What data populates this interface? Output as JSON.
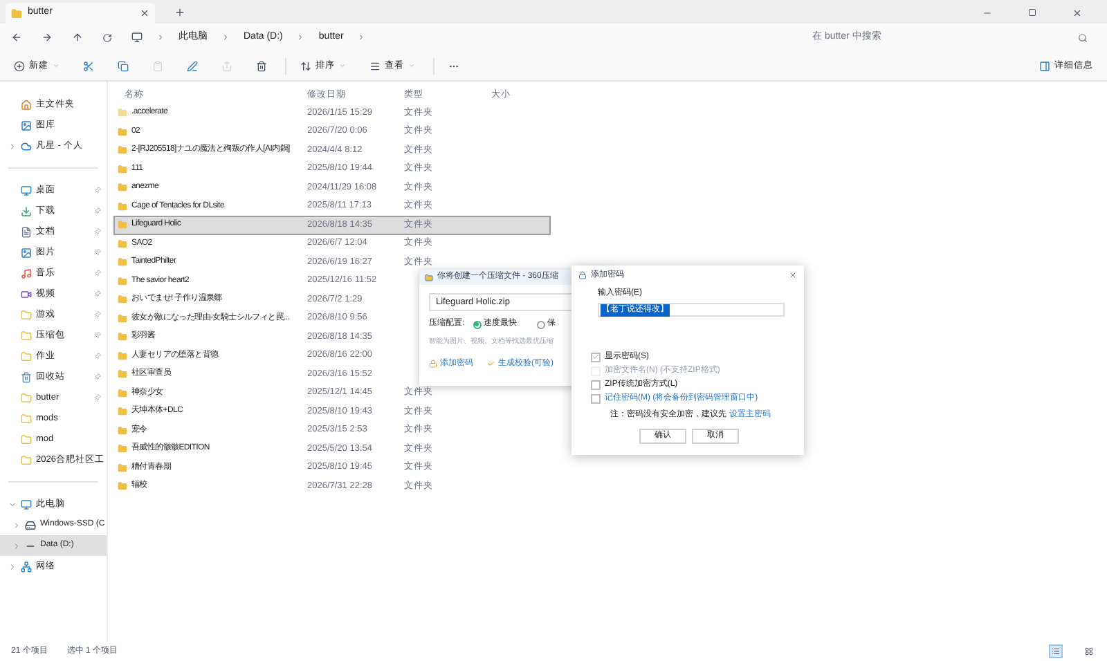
{
  "tab": {
    "title": "butter"
  },
  "address": {
    "breadcrumbs": [
      "此电脑",
      "Data (D:)",
      "butter"
    ],
    "search": {
      "placeholder": "在 butter 中搜索"
    }
  },
  "toolbar": {
    "actions": [
      {
        "kind": "new",
        "label": "新建",
        "disabled": false
      },
      {
        "kind": "cut",
        "disabled": false
      },
      {
        "kind": "copy",
        "disabled": false
      },
      {
        "kind": "paste",
        "disabled": true
      },
      {
        "kind": "rename",
        "disabled": false
      },
      {
        "kind": "share",
        "disabled": true
      },
      {
        "kind": "delete",
        "disabled": false
      },
      {
        "kind": "sort",
        "label": "排序",
        "disabled": false
      },
      {
        "kind": "view",
        "label": "查看",
        "disabled": false
      },
      {
        "kind": "more",
        "disabled": false
      }
    ],
    "details": "详细信息"
  },
  "sidebar": {
    "top": [
      {
        "kind": "home",
        "label": "主文件夹"
      },
      {
        "kind": "gallery",
        "label": "图库"
      },
      {
        "kind": "cloud",
        "label": "凡星 - 个人",
        "expandable": true
      }
    ],
    "quick": [
      {
        "kind": "desktop",
        "label": "桌面",
        "pinned": true
      },
      {
        "kind": "download",
        "label": "下载",
        "pinned": true
      },
      {
        "kind": "document",
        "label": "文档",
        "pinned": true
      },
      {
        "kind": "picture",
        "label": "图片",
        "pinned": true
      },
      {
        "kind": "music",
        "label": "音乐",
        "pinned": true
      },
      {
        "kind": "video",
        "label": "视频",
        "pinned": true
      },
      {
        "kind": "folder",
        "label": "游戏",
        "pinned": true
      },
      {
        "kind": "folder",
        "label": "压缩包",
        "pinned": true
      },
      {
        "kind": "folder",
        "label": "作业",
        "pinned": true
      },
      {
        "kind": "recycle",
        "label": "回收站",
        "pinned": true
      },
      {
        "kind": "folder",
        "label": "butter",
        "pinned": true
      },
      {
        "kind": "folder",
        "label": "mods",
        "pinned": false
      },
      {
        "kind": "folder",
        "label": "mod",
        "pinned": false
      },
      {
        "kind": "folder",
        "label": "2026合肥社区工"
      }
    ],
    "tree": [
      {
        "kind": "pc",
        "label": "此电脑",
        "expanded": true,
        "selected": false,
        "children": [
          {
            "kind": "ssd",
            "label": "Windows-SSD (C",
            "selected": false
          },
          {
            "kind": "drive",
            "label": "Data (D:)",
            "selected": true
          }
        ]
      },
      {
        "kind": "network",
        "label": "网络",
        "expanded": false,
        "selected": false
      }
    ]
  },
  "table": {
    "columns": [
      "名称",
      "修改日期",
      "类型",
      "大小"
    ],
    "rows": [
      {
        "name": ".accelerate",
        "date": "2026/1/15 15:29",
        "type": "文件夹",
        "selected": false,
        "hidden_item": true
      },
      {
        "name": "02",
        "date": "2026/7/20 0:06",
        "type": "文件夹",
        "selected": false
      },
      {
        "name": "2-[RJ205518]ナユの魔法と殉叛の作人[AI内鍋]",
        "date": "2024/4/4 8:12",
        "type": "文件夹",
        "selected": false
      },
      {
        "name": "111",
        "date": "2025/8/10 19:44",
        "type": "文件夹",
        "selected": false
      },
      {
        "name": "anezme",
        "date": "2024/11/29 16:08",
        "type": "文件夹",
        "selected": false
      },
      {
        "name": "Cage of Tentacles for DLsite",
        "date": "2025/8/11 17:13",
        "type": "文件夹",
        "selected": false
      },
      {
        "name": "Lifeguard Holic",
        "date": "2026/8/18 14:35",
        "type": "文件夹",
        "selected": true
      },
      {
        "name": "SAO2",
        "date": "2026/6/7 12:04",
        "type": "文件夹",
        "selected": false
      },
      {
        "name": "TaintedPhilter",
        "date": "2026/6/19 16:27",
        "type": "文件夹",
        "selected": false
      },
      {
        "name": "The savior heart2",
        "date": "2025/12/16 11:52",
        "selected": false
      },
      {
        "name": "おいでませ! 子作り温泉郷",
        "date": "2026/7/2 1:29",
        "selected": false
      },
      {
        "name": "彼女が敵になった理由-女騎士シルフィと罠...",
        "date": "2026/8/10 9:56",
        "selected": false
      },
      {
        "name": "彩羽酱",
        "date": "2026/8/18 14:35",
        "selected": false
      },
      {
        "name": "人妻セリアの堕落と背徳",
        "date": "2026/8/16 22:00",
        "selected": false
      },
      {
        "name": "社区审查员",
        "date": "2026/3/16 15:52",
        "selected": false
      },
      {
        "name": "神奈少女",
        "date": "2025/12/1 14:45",
        "type": "文件夹",
        "selected": false
      },
      {
        "name": "天坤本体+DLC",
        "date": "2025/8/10 19:43",
        "type": "文件夹",
        "selected": false
      },
      {
        "name": "宠令",
        "date": "2025/3/15 2:53",
        "type": "文件夹",
        "selected": false
      },
      {
        "name": "吾威性的骸骸EDITION",
        "date": "2025/5/20 13:54",
        "type": "文件夹",
        "selected": false
      },
      {
        "name": "糟付青春期",
        "date": "2025/8/10 19:45",
        "type": "文件夹",
        "selected": false
      },
      {
        "name": "辐校",
        "date": "2026/7/31 22:28",
        "type": "文件夹",
        "selected": false
      }
    ]
  },
  "compress_dialog": {
    "title": "你将创建一个压缩文件 - 360压缩",
    "filename": "Lifeguard Holic.zip",
    "config_label": "压缩配置:",
    "options": [
      {
        "label": "速度最快",
        "selected": true
      },
      {
        "label": "保",
        "selected": false
      }
    ],
    "hint": "智能为图片、视频、文档等找选最优压缩",
    "links": [
      {
        "kind": "lock",
        "label": "添加密码"
      },
      {
        "kind": "check",
        "label": "生成校验(可验)"
      }
    ]
  },
  "password_dialog": {
    "title": "添加密码",
    "input_label": "输入密码(E)",
    "input_value": "【老丁说还得改】",
    "options": [
      {
        "label": "显示密码(S)",
        "checked": true,
        "disabled": false,
        "link": false
      },
      {
        "label": "加密文件名(N) (不支持ZIP格式)",
        "checked": false,
        "disabled": true,
        "link": false
      },
      {
        "label": "ZIP传统加密方式(L)",
        "checked": false,
        "disabled": false,
        "link": false
      },
      {
        "label": "记住密码(M) (将会备份到密码管理窗口中)",
        "checked": false,
        "disabled": false,
        "link": true
      }
    ],
    "note": "注：密码没有安全加密，建议先",
    "note_link": "设置主密码",
    "buttons": [
      "确认",
      "取消"
    ]
  },
  "status_bar": {
    "count": "21 个项目",
    "selection": "选中 1 个项目",
    "views": [
      {
        "kind": "details",
        "selected": true
      },
      {
        "kind": "tiles",
        "selected": false
      }
    ]
  }
}
